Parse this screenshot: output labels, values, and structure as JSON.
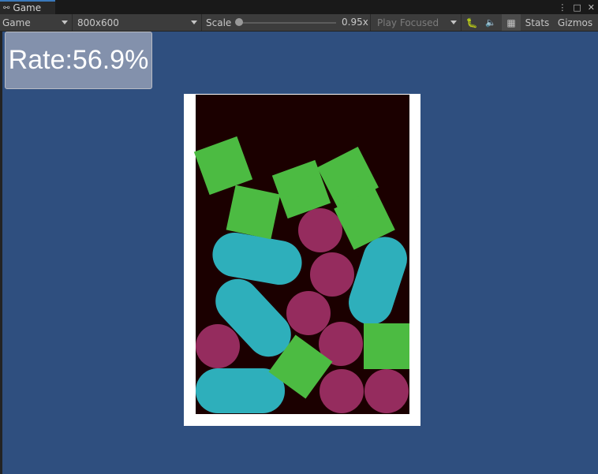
{
  "tab": {
    "title": "Game",
    "icon": "gamepad-icon"
  },
  "toolbar": {
    "display": "Game",
    "resolution": "800x600",
    "scale_label": "Scale",
    "scale_value": "0.95x",
    "play_mode": "Play Focused",
    "stats_label": "Stats",
    "gizmos_label": "Gizmos",
    "icons": [
      "bug-icon",
      "audio-mute-icon",
      "gizmo-grid-icon"
    ]
  },
  "hud": {
    "rate_text": "Rate:56.9%"
  },
  "colors": {
    "background": "#2f4f7f",
    "container_wall": "#ffffff",
    "container_interior": "#1b0000",
    "square": "#4cbb42",
    "circle": "#952c5e",
    "capsule": "#2eafbb"
  }
}
